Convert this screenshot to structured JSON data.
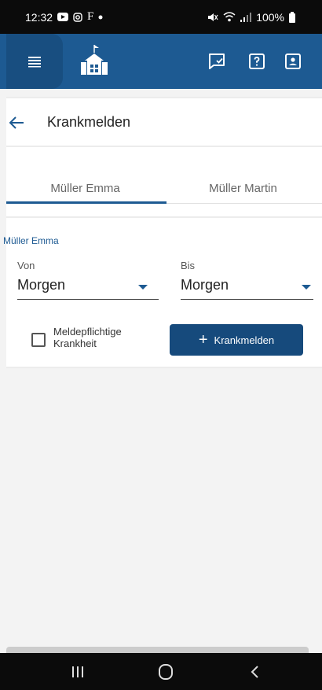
{
  "status_bar": {
    "time": "12:32",
    "carrier_glyph": "F",
    "battery": "100%"
  },
  "app_bar": {
    "icons": [
      "menu-icon",
      "school-logo-icon",
      "chat-check-icon",
      "help-icon",
      "account-box-icon"
    ]
  },
  "page": {
    "title": "Krankmelden"
  },
  "tabs": [
    {
      "label": "Müller Emma",
      "selected": true
    },
    {
      "label": "Müller Martin",
      "selected": false
    }
  ],
  "form": {
    "section_label": "Müller Emma",
    "from": {
      "label": "Von",
      "value": "Morgen"
    },
    "to": {
      "label": "Bis",
      "value": "Morgen"
    },
    "checkbox_label": "Meldepflichtige Krankheit",
    "checkbox_checked": false,
    "submit_label": "Krankmelden"
  },
  "colors": {
    "primary": "#1d5a92",
    "button": "#164a7c"
  }
}
